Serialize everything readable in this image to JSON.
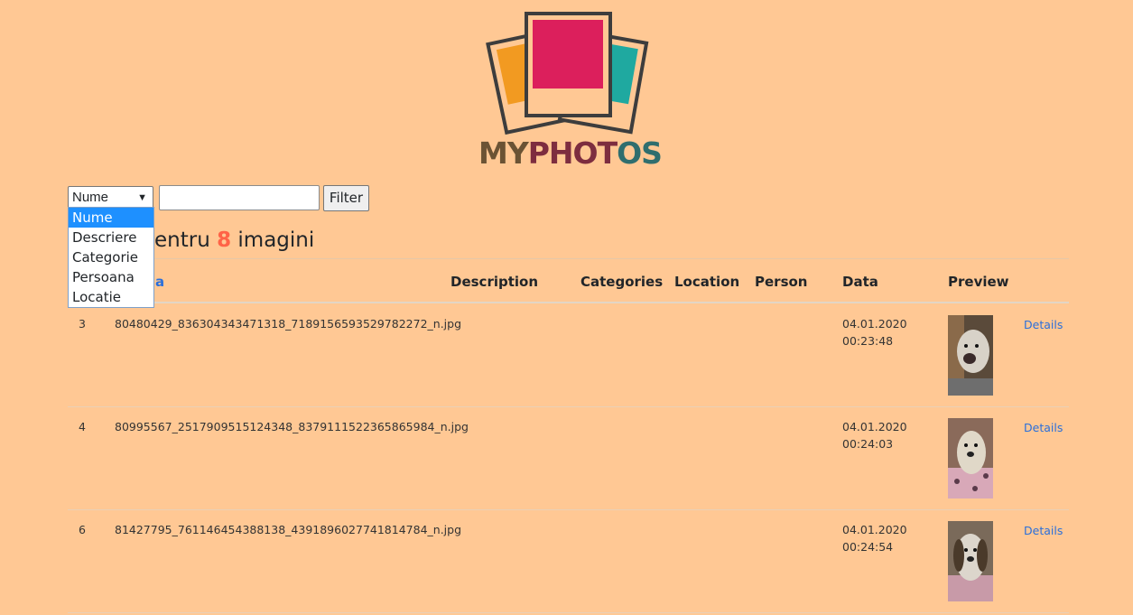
{
  "logo": {
    "text_part1": "MY",
    "text_part2": "PHOT",
    "text_part3": "OS"
  },
  "filter": {
    "selected": "Nume",
    "options": [
      "Nume",
      "Descriere",
      "Categorie",
      "Persoana",
      "Locatie"
    ],
    "input_value": "",
    "button_label": "Filter"
  },
  "results": {
    "prefix": "entru ",
    "count": "8",
    "suffix": " imagini"
  },
  "table": {
    "headers": [
      "Description",
      "Categories",
      "Location",
      "Person",
      "Data",
      "Preview"
    ],
    "partial_header": "a",
    "rows": [
      {
        "id": "3",
        "name": "80480429_836304343471318_7189156593529782272_n.jpg",
        "date": "04.01.2020",
        "time": "00:23:48",
        "link": "Details"
      },
      {
        "id": "4",
        "name": "80995567_2517909515124348_8379111522365865984_n.jpg",
        "date": "04.01.2020",
        "time": "00:24:03",
        "link": "Details"
      },
      {
        "id": "6",
        "name": "81427795_761146454388138_4391896027741814784_n.jpg",
        "date": "04.01.2020",
        "time": "00:24:54",
        "link": "Details"
      }
    ]
  },
  "colors": {
    "background": "#ffc894",
    "count": "#ff6347",
    "link": "#2a6fdb",
    "dropdown_selected": "#1e90ff"
  }
}
